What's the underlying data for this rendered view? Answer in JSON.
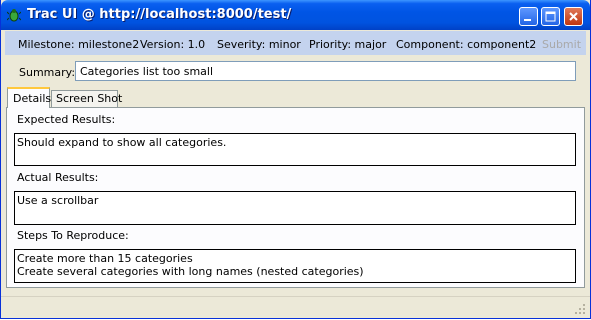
{
  "window": {
    "title": "Trac UI @ http://localhost:8000/test/",
    "icon": "bug-icon",
    "controls": [
      "minimize",
      "maximize",
      "close"
    ]
  },
  "fields": {
    "milestone": "Milestone: milestone2",
    "version": "Version: 1.0",
    "severity": "Severity: minor",
    "priority": "Priority: major",
    "component": "Component: component2",
    "submit_label": "Submit"
  },
  "summary": {
    "label": "Summary:",
    "value": "Categories list too small"
  },
  "tabs": [
    {
      "label": "Details",
      "active": true
    },
    {
      "label": "Screen Shot",
      "active": false
    }
  ],
  "details": {
    "expected_label": "Expected Results:",
    "expected_value": "Should expand to show all categories.",
    "actual_label": "Actual Results:",
    "actual_value": "Use a scrollbar",
    "steps_label": "Steps To Reproduce:",
    "steps_value": "Create more than 15 categories\nCreate several categories with long names (nested categories)"
  },
  "colors": {
    "titlebar": "#0055e5",
    "fieldbar": "#c4d3ee",
    "tab_highlight": "#ffc83c",
    "window_bg": "#ece9d8"
  }
}
